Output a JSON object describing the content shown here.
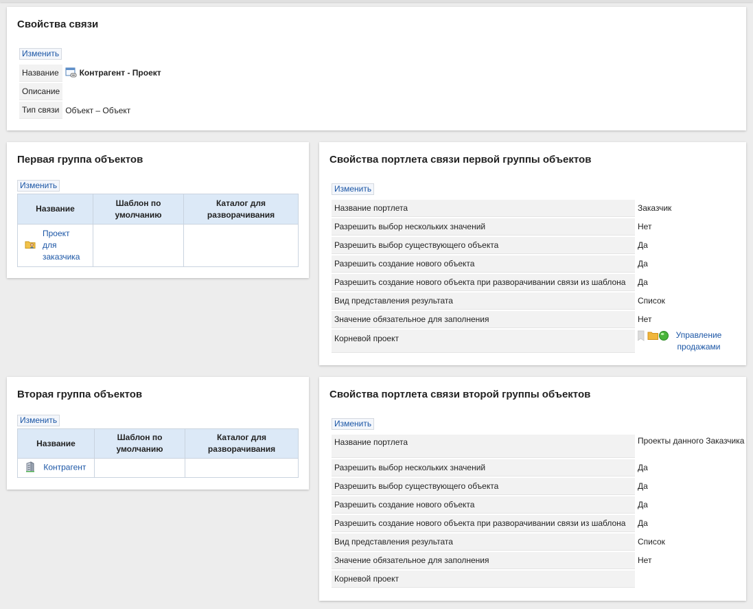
{
  "link_props": {
    "title": "Свойства связи",
    "edit_label": "Изменить",
    "rows": [
      {
        "label": "Название",
        "value": "Контрагент - Проект"
      },
      {
        "label": "Описание",
        "value": ""
      },
      {
        "label": "Тип связи",
        "value": "Объект – Объект"
      }
    ]
  },
  "group1": {
    "title": "Первая группа объектов",
    "edit_label": "Изменить",
    "columns": [
      "Название",
      "Шаблон по умолчанию",
      "Каталог для разворачивания"
    ],
    "rows": [
      {
        "name": "Проект для заказчика",
        "name_lines": [
          "Проект",
          "для",
          "заказчика"
        ],
        "template": "",
        "catalog": ""
      }
    ]
  },
  "group2": {
    "title": "Вторая группа объектов",
    "edit_label": "Изменить",
    "columns": [
      "Название",
      "Шаблон по умолчанию",
      "Каталог для разворачивания"
    ],
    "rows": [
      {
        "name": "Контрагент",
        "template": "",
        "catalog": ""
      }
    ]
  },
  "portlet1": {
    "title": "Свойства портлета связи первой группы объектов",
    "edit_label": "Изменить",
    "rows": [
      {
        "label": "Название портлета",
        "value": "Заказчик"
      },
      {
        "label": "Разрешить выбор нескольких значений",
        "value": "Нет"
      },
      {
        "label": "Разрешить выбор существующего объекта",
        "value": "Да"
      },
      {
        "label": "Разрешить создание нового объекта",
        "value": "Да"
      },
      {
        "label": "Разрешить создание нового объекта при разворачивании связи из шаблона",
        "value": "Да"
      },
      {
        "label": "Вид представления результата",
        "value": "Список"
      },
      {
        "label": "Значение обязательное для заполнения",
        "value": "Нет"
      },
      {
        "label": "Корневой проект",
        "value": ""
      }
    ],
    "root_project_link": "Управление продажами"
  },
  "portlet2": {
    "title": "Свойства портлета связи второй группы объектов",
    "edit_label": "Изменить",
    "rows": [
      {
        "label": "Название портлета",
        "value": "Проекты данного Заказчика"
      },
      {
        "label": "Разрешить выбор нескольких значений",
        "value": "Да"
      },
      {
        "label": "Разрешить выбор существующего объекта",
        "value": "Да"
      },
      {
        "label": "Разрешить создание нового объекта",
        "value": "Да"
      },
      {
        "label": "Разрешить создание нового объекта при разворачивании связи из шаблона",
        "value": "Да"
      },
      {
        "label": "Вид представления результата",
        "value": "Список"
      },
      {
        "label": "Значение обязательное для заполнения",
        "value": "Нет"
      },
      {
        "label": "Корневой проект",
        "value": ""
      }
    ]
  },
  "icons": {
    "link_type": "link-window-icon",
    "project_folder": "folder-user-icon",
    "counterparty": "building-icon",
    "root_project": "folder-globe-icon"
  }
}
